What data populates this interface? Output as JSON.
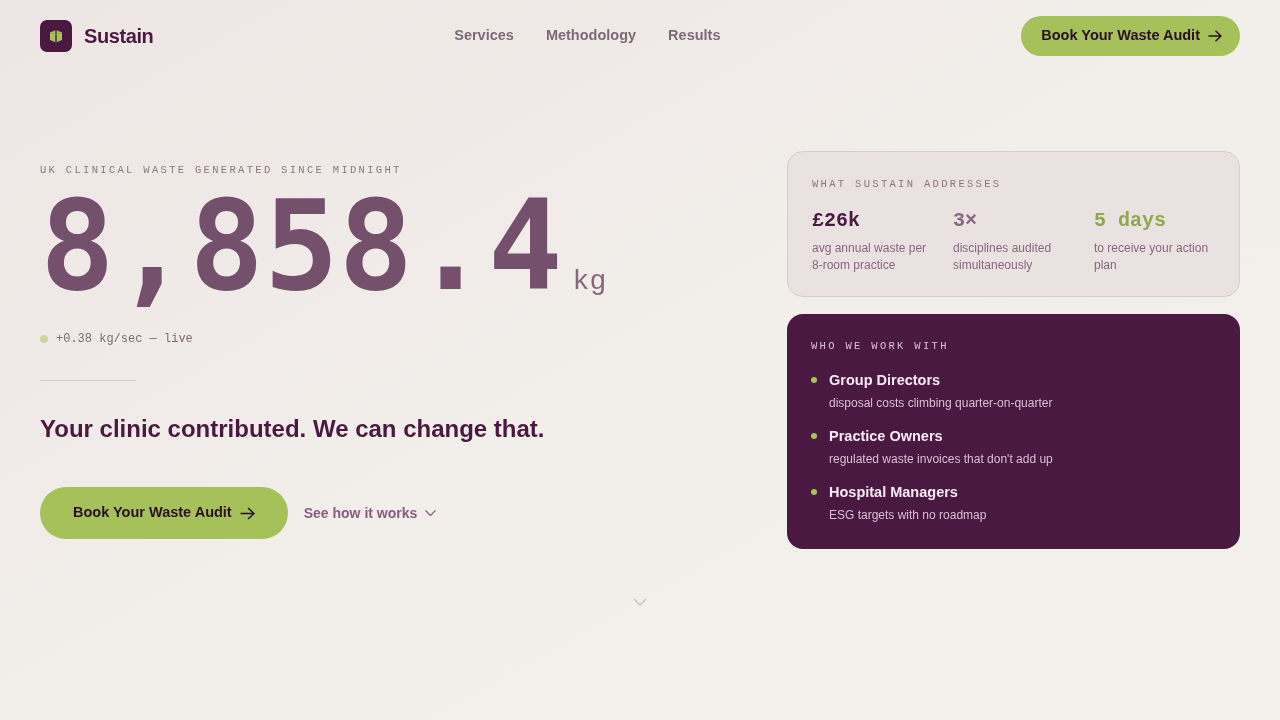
{
  "header": {
    "logo": {
      "name": "Sustain"
    },
    "nav": [
      {
        "label": "Services"
      },
      {
        "label": "Methodology"
      },
      {
        "label": "Results"
      }
    ],
    "cta": {
      "label": "Book Your Waste Audit"
    }
  },
  "hero": {
    "eyebrow": "UK CLINICAL WASTE GENERATED SINCE MIDNIGHT",
    "counter": {
      "value": "8,858.4",
      "unit": "kg"
    },
    "rate": "+0.38 kg/sec — live",
    "headline": "Your clinic contributed. We can change that.",
    "primary_button": {
      "label": "Book Your Waste Audit"
    },
    "secondary_link": {
      "label": "See how it works"
    }
  },
  "addresses_card": {
    "title": "WHAT SUSTAIN ADDRESSES",
    "stats": [
      {
        "value": "£26k",
        "description": "avg annual waste per 8-room practice",
        "color": "#4a1942"
      },
      {
        "value": "3×",
        "description": "disciplines audited simultaneously",
        "color": "#8a6580"
      },
      {
        "value": "5 days",
        "description": "to receive your action plan",
        "color": "#8fa84a"
      }
    ]
  },
  "audience_card": {
    "title": "WHO WE WORK WITH",
    "items": [
      {
        "title": "Group Directors",
        "description": "disposal costs climbing quarter-on-quarter"
      },
      {
        "title": "Practice Owners",
        "description": "regulated waste invoices that don't add up"
      },
      {
        "title": "Hospital Managers",
        "description": "ESG targets with no roadmap"
      }
    ]
  }
}
